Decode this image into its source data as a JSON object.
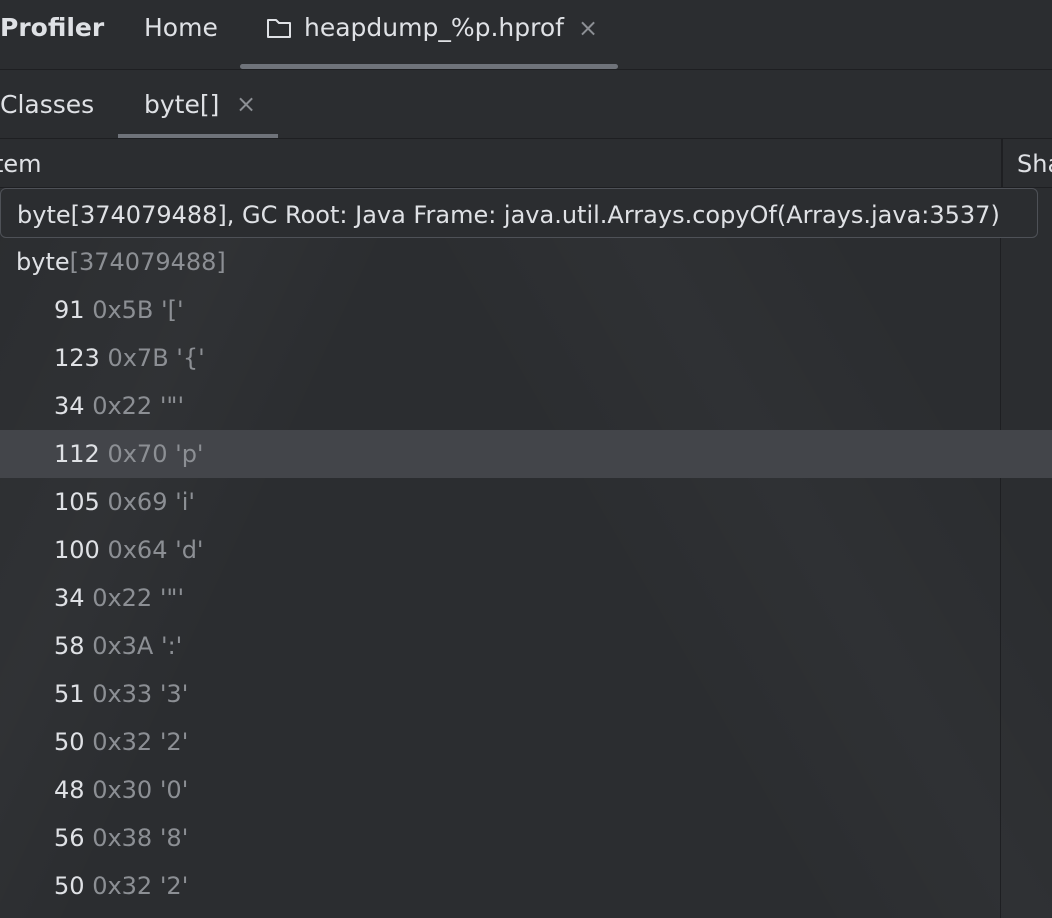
{
  "toolwindow": {
    "title": "Profiler",
    "tabs": [
      {
        "label": "Home"
      },
      {
        "label": "heapdump_%p.hprof",
        "icon": "folder-icon",
        "close_glyph": "×"
      }
    ]
  },
  "subtabs": [
    {
      "label": "Classes"
    },
    {
      "label": "byte[]",
      "close_glyph": "×"
    }
  ],
  "table": {
    "columns": [
      "tem",
      "Sha"
    ],
    "tooltip": {
      "primary": "byte",
      "secondary": "[374079488], GC Root: Java Frame: java.util.Arrays.copyOf(Arrays.java:3537)"
    },
    "root_row": {
      "primary": "byte",
      "secondary": "[374079488]"
    },
    "rows": [
      {
        "value": "91",
        "detail": "0x5B '['"
      },
      {
        "value": "123",
        "detail": "0x7B '{'"
      },
      {
        "value": "34",
        "detail": "0x22 '\"'"
      },
      {
        "value": "112",
        "detail": "0x70 'p'"
      },
      {
        "value": "105",
        "detail": "0x69 'i'"
      },
      {
        "value": "100",
        "detail": "0x64 'd'"
      },
      {
        "value": "34",
        "detail": "0x22 '\"'"
      },
      {
        "value": "58",
        "detail": "0x3A ':'"
      },
      {
        "value": "51",
        "detail": "0x33 '3'"
      },
      {
        "value": "50",
        "detail": "0x32 '2'"
      },
      {
        "value": "48",
        "detail": "0x30 '0'"
      },
      {
        "value": "56",
        "detail": "0x38 '8'"
      },
      {
        "value": "50",
        "detail": "0x32 '2'"
      }
    ],
    "selected_row_index": 3
  },
  "colors": {
    "background": "#2b2d30",
    "selection": "#43454a",
    "text_primary": "#dfe1e5",
    "text_secondary": "#8c8f94"
  }
}
